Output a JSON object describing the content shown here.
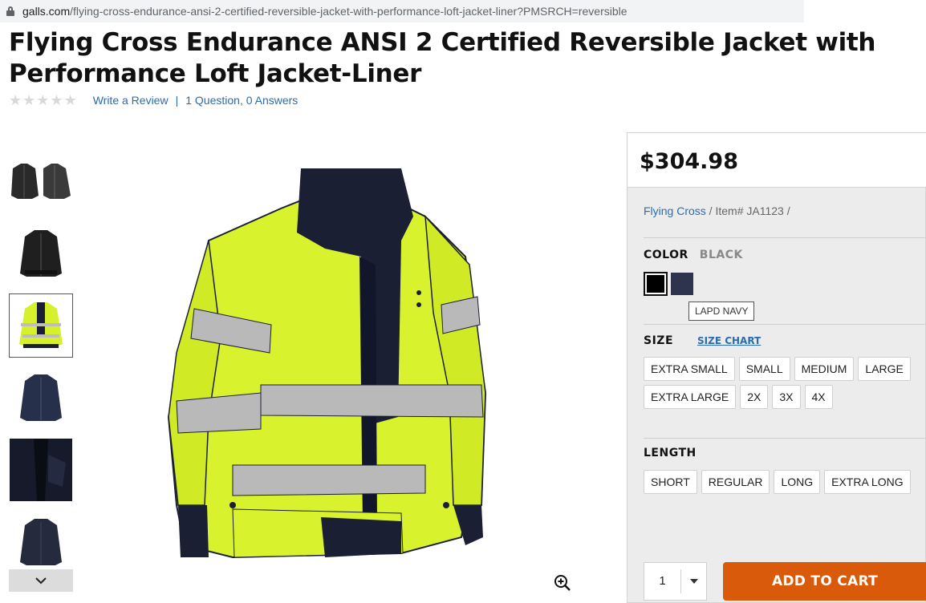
{
  "browser": {
    "url_domain": "galls.com",
    "url_path": "/flying-cross-endurance-ansi-2-certified-reversible-jacket-with-performance-loft-jacket-liner?PMSRCH=reversible"
  },
  "product": {
    "title": "Flying Cross Endurance ANSI 2 Certified Reversible Jacket with Performance Loft Jacket-Liner",
    "rating_stars": 0,
    "write_review": "Write a Review",
    "separator": "|",
    "questions": "1 Question, 0 Answers"
  },
  "gallery": {
    "thumbnails": [
      {
        "color": "#2a2a2a",
        "name": "black jackets pair"
      },
      {
        "color": "#1f1f1f",
        "name": "black jacket"
      },
      {
        "color": "#d6f02b",
        "name": "hi-vis jacket",
        "active": true
      },
      {
        "color": "#27304a",
        "name": "navy jacket"
      },
      {
        "color": "#161a2a",
        "name": "jacket interior"
      },
      {
        "color": "#262a3d",
        "name": "navy liner"
      }
    ],
    "hi_vis_color": "#d8f22e",
    "navy_color": "#1a1f33",
    "reflective_color": "#b9b9b9"
  },
  "panel": {
    "price": "$304.98",
    "brand": "Flying Cross",
    "item": " / Item# JA1123 /",
    "color_label": "COLOR",
    "color_value": "BLACK",
    "swatch_tooltip": "LAPD NAVY",
    "size_label": "SIZE",
    "size_chart": "SIZE CHART",
    "sizes_row1": [
      "EXTRA SMALL",
      "SMALL",
      "MEDIUM",
      "LARGE"
    ],
    "sizes_row2": [
      "EXTRA LARGE",
      "2X",
      "3X",
      "4X"
    ],
    "length_label": "LENGTH",
    "lengths": [
      "SHORT",
      "REGULAR",
      "LONG",
      "EXTRA LONG"
    ],
    "quantity": "1",
    "add_to_cart": "ADD TO CART",
    "accent_color": "#d95a0a",
    "link_color": "#2b6cb0"
  }
}
